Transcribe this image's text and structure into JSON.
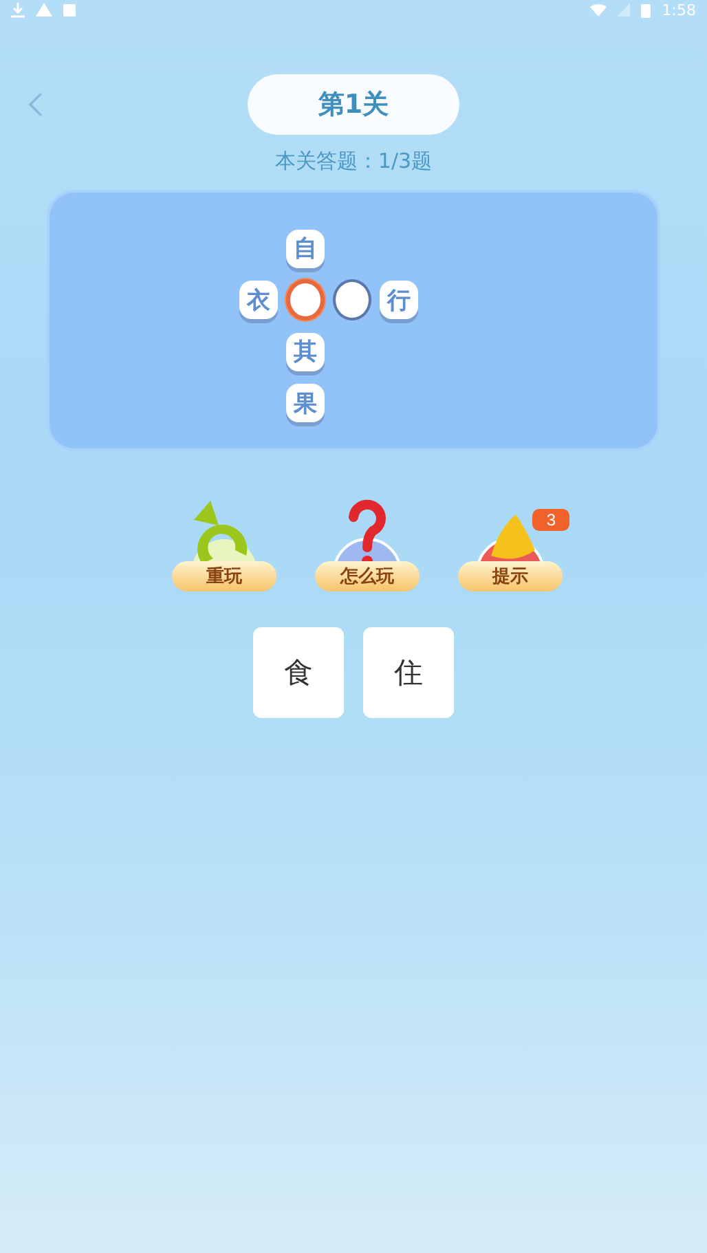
{
  "status_bar": {
    "time": "1:58"
  },
  "header": {
    "title": "第1关",
    "progress": "本关答题：1/3题"
  },
  "grid": {
    "above": [
      {
        "kind": "letter",
        "char": "自"
      }
    ],
    "across": [
      {
        "kind": "letter",
        "char": "衣"
      },
      {
        "kind": "blank",
        "selected": true
      },
      {
        "kind": "blank",
        "selected": false
      },
      {
        "kind": "letter",
        "char": "行"
      }
    ],
    "below": [
      {
        "kind": "letter",
        "char": "其"
      },
      {
        "kind": "letter",
        "char": "果"
      }
    ]
  },
  "actions": [
    {
      "kind": "replay",
      "label": "重玩"
    },
    {
      "kind": "help",
      "label": "怎么玩"
    },
    {
      "kind": "hint",
      "label": "提示",
      "badge": "3"
    }
  ],
  "choices": [
    "食",
    "住"
  ]
}
